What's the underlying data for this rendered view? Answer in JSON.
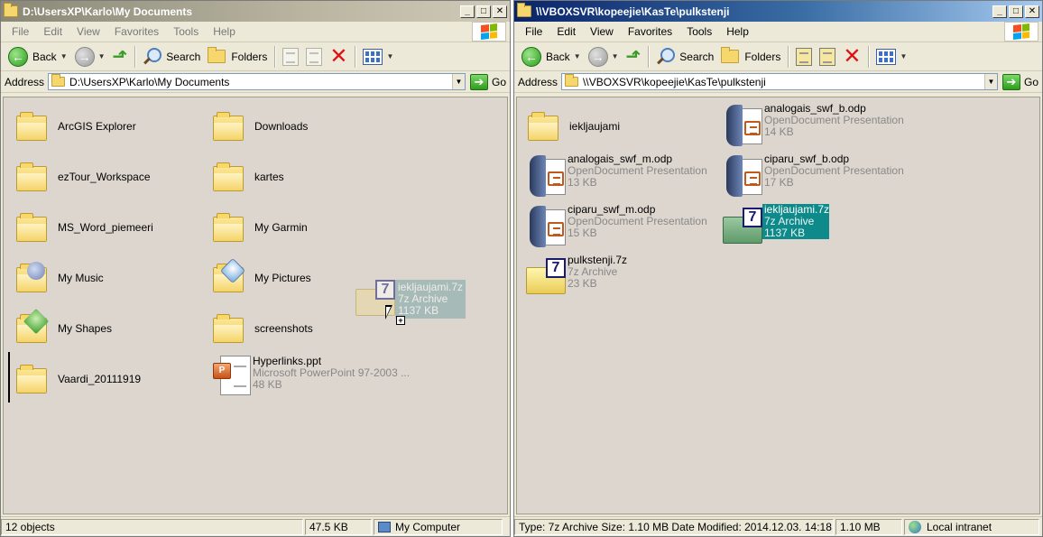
{
  "left_window": {
    "title": "D:\\UsersXP\\Karlo\\My Documents",
    "menu": [
      "File",
      "Edit",
      "View",
      "Favorites",
      "Tools",
      "Help"
    ],
    "toolbar": {
      "back_label": "Back",
      "search_label": "Search",
      "folders_label": "Folders"
    },
    "address": {
      "label": "Address",
      "value": "D:\\UsersXP\\Karlo\\My Documents",
      "go_label": "Go"
    },
    "items": [
      {
        "name": "ArcGIS Explorer",
        "kind": "folder"
      },
      {
        "name": "Downloads",
        "kind": "folder"
      },
      {
        "name": "ezTour_Workspace",
        "kind": "folder"
      },
      {
        "name": "kartes",
        "kind": "folder"
      },
      {
        "name": "MS_Word_piemeeri",
        "kind": "folder"
      },
      {
        "name": "My Garmin",
        "kind": "folder"
      },
      {
        "name": "My Music",
        "kind": "folder-music"
      },
      {
        "name": "My Pictures",
        "kind": "folder-pictures"
      },
      {
        "name": "My Shapes",
        "kind": "folder-shapes"
      },
      {
        "name": "screenshots",
        "kind": "folder"
      },
      {
        "name": "Vaardi_20111919",
        "kind": "folder"
      },
      {
        "name": "Hyperlinks.ppt",
        "type": "Microsoft PowerPoint 97-2003 ...",
        "size": "48 KB",
        "kind": "ppt"
      }
    ],
    "drag_ghost": {
      "name": "iekljaujami.7z",
      "type": "7z Archive",
      "size": "1137 KB"
    },
    "status": {
      "objects": "12 objects",
      "size": "47.5 KB",
      "zone": "My Computer"
    }
  },
  "right_window": {
    "title": "\\\\VBOXSVR\\kopeejie\\KasTe\\pulkstenji",
    "menu": [
      "File",
      "Edit",
      "View",
      "Favorites",
      "Tools",
      "Help"
    ],
    "toolbar": {
      "back_label": "Back",
      "search_label": "Search",
      "folders_label": "Folders"
    },
    "address": {
      "label": "Address",
      "value": "\\\\VBOXSVR\\kopeejie\\KasTe\\pulkstenji",
      "go_label": "Go"
    },
    "items": [
      {
        "name": "iekljaujami",
        "kind": "folder"
      },
      {
        "name": "analogais_swf_b.odp",
        "type": "OpenDocument Presentation",
        "size": "14 KB",
        "kind": "odp"
      },
      {
        "name": "analogais_swf_m.odp",
        "type": "OpenDocument Presentation",
        "size": "13 KB",
        "kind": "odp"
      },
      {
        "name": "ciparu_swf_b.odp",
        "type": "OpenDocument Presentation",
        "size": "17 KB",
        "kind": "odp"
      },
      {
        "name": "ciparu_swf_m.odp",
        "type": "OpenDocument Presentation",
        "size": "15 KB",
        "kind": "odp"
      },
      {
        "name": "iekljaujami.7z",
        "type": "7z Archive",
        "size": "1137 KB",
        "kind": "7z",
        "selected": true
      },
      {
        "name": "pulkstenji.7z",
        "type": "7z Archive",
        "size": "23 KB",
        "kind": "7z"
      }
    ],
    "status": {
      "info": "Type: 7z Archive Size: 1.10 MB Date Modified: 2014.12.03. 14:18",
      "size": "1.10 MB",
      "zone": "Local intranet"
    }
  }
}
